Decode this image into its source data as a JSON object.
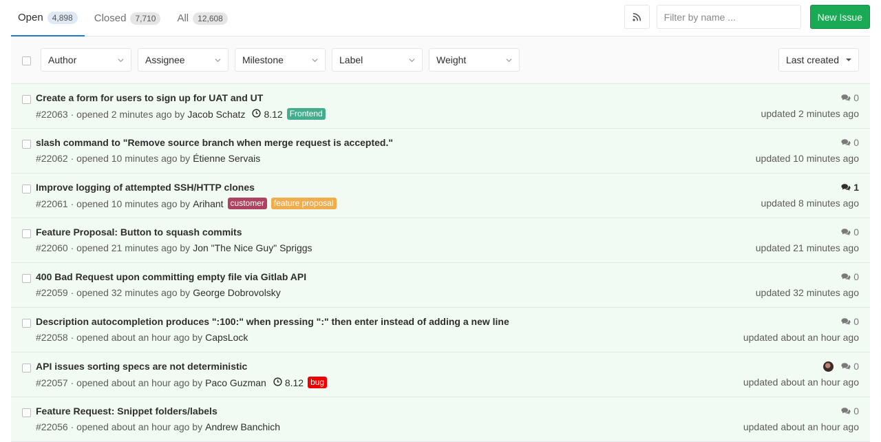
{
  "tabs": [
    {
      "label": "Open",
      "count": "4,898"
    },
    {
      "label": "Closed",
      "count": "7,710"
    },
    {
      "label": "All",
      "count": "12,608"
    }
  ],
  "filter": {
    "placeholder": "Filter by name ..."
  },
  "new_issue_label": "New Issue",
  "rss_icon": "rss-icon",
  "dropdowns": [
    "Author",
    "Assignee",
    "Milestone",
    "Label",
    "Weight"
  ],
  "sort": {
    "label": "Last created"
  },
  "issues": [
    {
      "title": "Create a form for users to sign up for UAT and UT",
      "number": "#22063",
      "opened": "· opened 2 minutes ago by",
      "author": "Jacob Schatz",
      "milestone": "8.12",
      "labels": [
        {
          "text": "Frontend",
          "color": "#44ad8e"
        }
      ],
      "comments": "0",
      "updated": "updated 2 minutes ago"
    },
    {
      "title": "slash command to \"Remove source branch when merge request is accepted.\"",
      "number": "#22062",
      "opened": "· opened 10 minutes ago by",
      "author": "Étienne Servais",
      "milestone": "",
      "labels": [],
      "comments": "0",
      "updated": "updated 10 minutes ago"
    },
    {
      "title": "Improve logging of attempted SSH/HTTP clones",
      "number": "#22061",
      "opened": "· opened 10 minutes ago by",
      "author": "Arihant",
      "milestone": "",
      "labels": [
        {
          "text": "customer",
          "color": "#ad4363"
        },
        {
          "text": "feature proposal",
          "color": "#f0ad4e"
        }
      ],
      "comments": "1",
      "updated": "updated 8 minutes ago"
    },
    {
      "title": "Feature Proposal: Button to squash commits",
      "number": "#22060",
      "opened": "· opened 21 minutes ago by",
      "author": "Jon \"The Nice Guy\" Spriggs",
      "milestone": "",
      "labels": [],
      "comments": "0",
      "updated": "updated 21 minutes ago"
    },
    {
      "title": "400 Bad Request upon committing empty file via Gitlab API",
      "number": "#22059",
      "opened": "· opened 32 minutes ago by",
      "author": "George Dobrovolsky",
      "milestone": "",
      "labels": [],
      "comments": "0",
      "updated": "updated 32 minutes ago"
    },
    {
      "title": "Description autocompletion produces \":100:\" when pressing \":\" then enter instead of adding a new line",
      "number": "#22058",
      "opened": "· opened about an hour ago by",
      "author": "CapsLock",
      "milestone": "",
      "labels": [],
      "comments": "0",
      "updated": "updated about an hour ago"
    },
    {
      "title": "API issues sorting specs are not deterministic",
      "number": "#22057",
      "opened": "· opened about an hour ago by",
      "author": "Paco Guzman",
      "milestone": "8.12",
      "labels": [
        {
          "text": "bug",
          "color": "#ee0000"
        }
      ],
      "comments": "0",
      "updated": "updated about an hour ago",
      "avatar": true
    },
    {
      "title": "Feature Request: Snippet folders/labels",
      "number": "#22056",
      "opened": "· opened about an hour ago by",
      "author": "Andrew Banchich",
      "milestone": "",
      "labels": [],
      "comments": "0",
      "updated": "updated about an hour ago"
    }
  ]
}
